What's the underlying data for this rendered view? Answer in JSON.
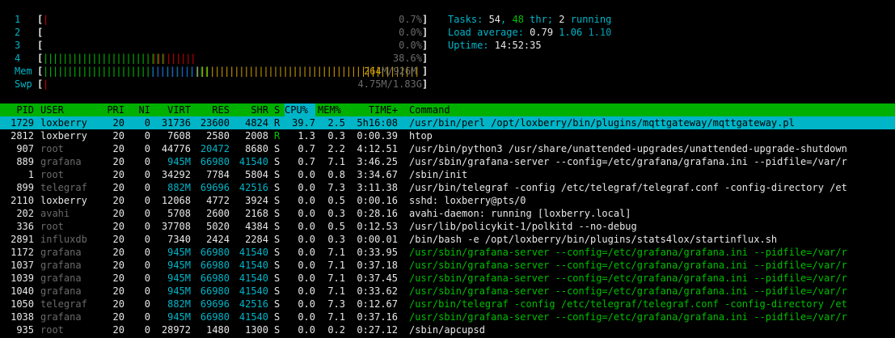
{
  "meters": {
    "cpu": [
      {
        "label": "1",
        "bar": "|",
        "bar_color": "red",
        "value": "0.7%"
      },
      {
        "label": "2",
        "bar": "",
        "bar_color": "red",
        "value": "0.0%"
      },
      {
        "label": "3",
        "bar": "",
        "bar_color": "red",
        "value": "0.0%"
      },
      {
        "label": "4",
        "bar_green": "|||||||||||||||||||||||||",
        "bar_red": "|||||||||",
        "value": "38.6%"
      }
    ],
    "mem": {
      "label": "Mem",
      "bar_green": "||||||||||||||||||||||||||||||||||",
      "bar_blue": "||||||||||",
      "bar_yellow": "||||||||||||||||||||||||||||||||||||||||||||||",
      "used": "264",
      "total": "M/926M"
    },
    "swp": {
      "label": "Swp",
      "bar": "|",
      "value": "4.75M/1.83G"
    }
  },
  "summary": {
    "tasks_label": "Tasks: ",
    "tasks": "54",
    "sep1": ", ",
    "threads": "48",
    "thr_label": " thr; ",
    "running": "2",
    "running_label": " running",
    "load_label": "Load average: ",
    "load1": "0.79",
    "load5": "1.06",
    "load15": "1.10",
    "uptime_label": "Uptime: ",
    "uptime": "14:52:35"
  },
  "header": {
    "pid": "PID",
    "user": "USER",
    "pri": "PRI",
    "ni": "NI",
    "virt": "VIRT",
    "res": "RES",
    "shr": "SHR",
    "s": "S",
    "cpu": "CPU%",
    "mem": "MEM%",
    "time": "TIME+",
    "command": "Command"
  },
  "processes": [
    {
      "pid": "1729",
      "user": "loxberry",
      "pri": "20",
      "ni": "0",
      "virt": "31736",
      "res": "23600",
      "shr": "4824",
      "s": "R",
      "cpu": "39.7",
      "mem": "2.5",
      "time": "5h16:08",
      "command": "/usr/bin/perl /opt/loxberry/bin/plugins/mqttgateway/mqttgateway.pl"
    },
    {
      "pid": "2812",
      "user": "loxberry",
      "pri": "20",
      "ni": "0",
      "virt": "7608",
      "res": "2580",
      "shr": "2008",
      "s": "R",
      "cpu": "1.3",
      "mem": "0.3",
      "time": "0:00.39",
      "command": "htop"
    },
    {
      "pid": "907",
      "user": "root",
      "pri": "20",
      "ni": "0",
      "virt": "44776",
      "res": "20472",
      "shr": "8680",
      "s": "S",
      "cpu": "0.7",
      "mem": "2.2",
      "time": "4:12.51",
      "command": "/usr/bin/python3 /usr/share/unattended-upgrades/unattended-upgrade-shutdown"
    },
    {
      "pid": "889",
      "user": "grafana",
      "pri": "20",
      "ni": "0",
      "virt": "945M",
      "res": "66980",
      "shr": "41540",
      "s": "S",
      "cpu": "0.7",
      "mem": "7.1",
      "time": "3:46.25",
      "command": "/usr/sbin/grafana-server --config=/etc/grafana/grafana.ini --pidfile=/var/r"
    },
    {
      "pid": "1",
      "user": "root",
      "pri": "20",
      "ni": "0",
      "virt": "34292",
      "res": "7784",
      "shr": "5804",
      "s": "S",
      "cpu": "0.0",
      "mem": "0.8",
      "time": "3:34.67",
      "command": "/sbin/init"
    },
    {
      "pid": "899",
      "user": "telegraf",
      "pri": "20",
      "ni": "0",
      "virt": "882M",
      "res": "69696",
      "shr": "42516",
      "s": "S",
      "cpu": "0.0",
      "mem": "7.3",
      "time": "3:11.38",
      "command": "/usr/bin/telegraf -config /etc/telegraf/telegraf.conf -config-directory /et"
    },
    {
      "pid": "2110",
      "user": "loxberry",
      "pri": "20",
      "ni": "0",
      "virt": "12068",
      "res": "4772",
      "shr": "3924",
      "s": "S",
      "cpu": "0.0",
      "mem": "0.5",
      "time": "0:00.16",
      "command": "sshd: loxberry@pts/0"
    },
    {
      "pid": "202",
      "user": "avahi",
      "pri": "20",
      "ni": "0",
      "virt": "5708",
      "res": "2600",
      "shr": "2168",
      "s": "S",
      "cpu": "0.0",
      "mem": "0.3",
      "time": "0:28.16",
      "command": "avahi-daemon: running [loxberry.local]"
    },
    {
      "pid": "336",
      "user": "root",
      "pri": "20",
      "ni": "0",
      "virt": "37708",
      "res": "5020",
      "shr": "4384",
      "s": "S",
      "cpu": "0.0",
      "mem": "0.5",
      "time": "0:12.53",
      "command": "/usr/lib/policykit-1/polkitd --no-debug"
    },
    {
      "pid": "2891",
      "user": "influxdb",
      "pri": "20",
      "ni": "0",
      "virt": "7340",
      "res": "2424",
      "shr": "2284",
      "s": "S",
      "cpu": "0.0",
      "mem": "0.3",
      "time": "0:00.01",
      "command": "/bin/bash -e /opt/loxberry/bin/plugins/stats4lox/startinflux.sh"
    },
    {
      "pid": "1172",
      "user": "grafana",
      "pri": "20",
      "ni": "0",
      "virt": "945M",
      "res": "66980",
      "shr": "41540",
      "s": "S",
      "cpu": "0.0",
      "mem": "7.1",
      "time": "0:33.95",
      "command": "/usr/sbin/grafana-server --config=/etc/grafana/grafana.ini --pidfile=/var/r",
      "thread": true
    },
    {
      "pid": "1037",
      "user": "grafana",
      "pri": "20",
      "ni": "0",
      "virt": "945M",
      "res": "66980",
      "shr": "41540",
      "s": "S",
      "cpu": "0.0",
      "mem": "7.1",
      "time": "0:37.18",
      "command": "/usr/sbin/grafana-server --config=/etc/grafana/grafana.ini --pidfile=/var/r",
      "thread": true
    },
    {
      "pid": "1039",
      "user": "grafana",
      "pri": "20",
      "ni": "0",
      "virt": "945M",
      "res": "66980",
      "shr": "41540",
      "s": "S",
      "cpu": "0.0",
      "mem": "7.1",
      "time": "0:37.45",
      "command": "/usr/sbin/grafana-server --config=/etc/grafana/grafana.ini --pidfile=/var/r",
      "thread": true
    },
    {
      "pid": "1040",
      "user": "grafana",
      "pri": "20",
      "ni": "0",
      "virt": "945M",
      "res": "66980",
      "shr": "41540",
      "s": "S",
      "cpu": "0.0",
      "mem": "7.1",
      "time": "0:33.62",
      "command": "/usr/sbin/grafana-server --config=/etc/grafana/grafana.ini --pidfile=/var/r",
      "thread": true
    },
    {
      "pid": "1050",
      "user": "telegraf",
      "pri": "20",
      "ni": "0",
      "virt": "882M",
      "res": "69696",
      "shr": "42516",
      "s": "S",
      "cpu": "0.0",
      "mem": "7.3",
      "time": "0:12.67",
      "command": "/usr/bin/telegraf -config /etc/telegraf/telegraf.conf -config-directory /et",
      "thread": true
    },
    {
      "pid": "1038",
      "user": "grafana",
      "pri": "20",
      "ni": "0",
      "virt": "945M",
      "res": "66980",
      "shr": "41540",
      "s": "S",
      "cpu": "0.0",
      "mem": "7.1",
      "time": "0:37.16",
      "command": "/usr/sbin/grafana-server --config=/etc/grafana/grafana.ini --pidfile=/var/r",
      "thread": true
    },
    {
      "pid": "935",
      "user": "root",
      "pri": "20",
      "ni": "0",
      "virt": "28972",
      "res": "1480",
      "shr": "1300",
      "s": "S",
      "cpu": "0.0",
      "mem": "0.2",
      "time": "0:27.12",
      "command": "/sbin/apcupsd"
    }
  ],
  "colors": {
    "header_bg": "#00b000",
    "selected_bg": "#00b5c8",
    "cpu_header_bg": "#00b5c8"
  }
}
